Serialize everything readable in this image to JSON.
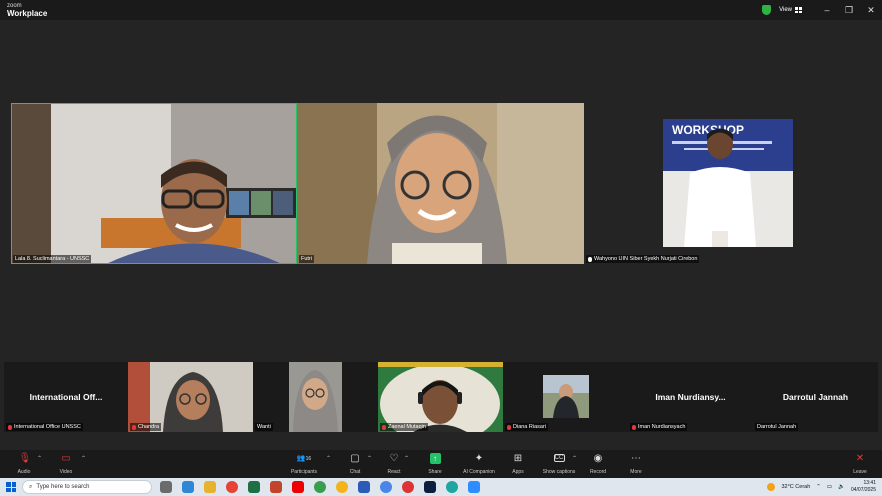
{
  "window": {
    "brand_line1": "zoom",
    "brand_line2": "Workplace",
    "view_label": "View",
    "controls": [
      "–",
      "❐",
      "✕"
    ]
  },
  "gallery": [
    {
      "name": "Lala 8. Suclimantara - UNSSC",
      "muted": true,
      "active": true
    },
    {
      "name": "Futri",
      "muted": false,
      "active": false
    },
    {
      "name": "Wahyono UIN Siber Syekh Nurjati Cirebon",
      "muted": false,
      "active": false
    }
  ],
  "strip": [
    {
      "name": "International Office UNSSC",
      "display": "International Off...",
      "muted": true,
      "video": false
    },
    {
      "name": "Chandra",
      "muted": true,
      "video": true
    },
    {
      "name": "Wanti",
      "muted": false,
      "video": true
    },
    {
      "name": "Zaenal Mutaqin",
      "muted": true,
      "video": true
    },
    {
      "name": "Diana Riasari",
      "muted": true,
      "video": true
    },
    {
      "name": "Iman Nurdiansyach",
      "display": "Iman Nurdiansy...",
      "muted": true,
      "video": false
    },
    {
      "name": "Darrotul Jannah",
      "display": "Darrotul Jannah",
      "muted": false,
      "video": false
    }
  ],
  "toolbar": {
    "audio": "Audio",
    "video": "Video",
    "participants": "Participants",
    "participants_count": "16",
    "chat": "Chat",
    "react": "React",
    "share": "Share",
    "ai": "AI Companion",
    "apps": "Apps",
    "captions": "Show captions",
    "record": "Record",
    "more": "More",
    "leave": "Leave"
  },
  "taskbar": {
    "search_placeholder": "Type here to search",
    "weather": "32°C  Cerah",
    "time": "13:41",
    "date": "04/07/2025"
  },
  "colors": {
    "active_speaker": "#27c36a",
    "muted": "#e03a3a",
    "share": "#26c06a"
  }
}
